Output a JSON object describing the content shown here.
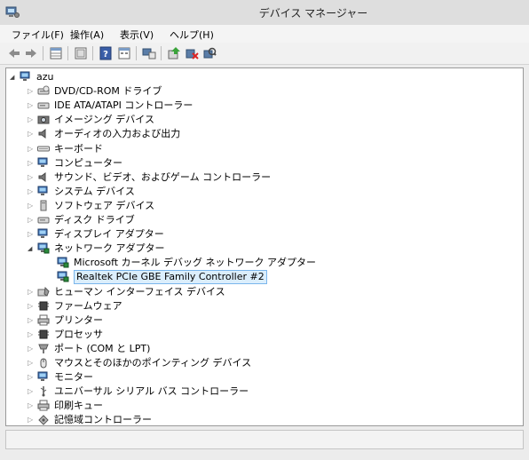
{
  "window": {
    "title": "デバイス マネージャー"
  },
  "menu": [
    "ファイル(F)",
    "操作(A)",
    "表示(V)",
    "ヘルプ(H)"
  ],
  "toolbar": {
    "buttons": [
      "back-icon",
      "forward-icon",
      "properties-grid-icon",
      "show-hide-tree-icon",
      "help-icon",
      "view-icon",
      "devices-icon",
      "update-driver-icon",
      "uninstall-icon",
      "scan-hardware-icon"
    ]
  },
  "tree": {
    "root": "azu",
    "categories": [
      {
        "label": "DVD/CD-ROM ドライブ",
        "icon": "dvd-drive-icon"
      },
      {
        "label": "IDE ATA/ATAPI コントローラー",
        "icon": "ide-controller-icon"
      },
      {
        "label": "イメージング デバイス",
        "icon": "imaging-device-icon"
      },
      {
        "label": "オーディオの入力および出力",
        "icon": "speaker-icon"
      },
      {
        "label": "キーボード",
        "icon": "keyboard-icon"
      },
      {
        "label": "コンピューター",
        "icon": "computer-icon"
      },
      {
        "label": "サウンド、ビデオ、およびゲーム コントローラー",
        "icon": "sound-icon"
      },
      {
        "label": "システム デバイス",
        "icon": "system-device-icon"
      },
      {
        "label": "ソフトウェア デバイス",
        "icon": "software-device-icon"
      },
      {
        "label": "ディスク ドライブ",
        "icon": "disk-drive-icon"
      },
      {
        "label": "ディスプレイ アダプター",
        "icon": "display-adapter-icon"
      },
      {
        "label": "ネットワーク アダプター",
        "icon": "network-adapter-icon",
        "expanded": true,
        "children": [
          {
            "label": "Microsoft カーネル デバッグ ネットワーク アダプター",
            "icon": "network-card-icon"
          },
          {
            "label": "Realtek PCIe GBE Family Controller #2",
            "icon": "network-card-icon",
            "selected": true
          }
        ]
      },
      {
        "label": "ヒューマン インターフェイス デバイス",
        "icon": "hid-icon"
      },
      {
        "label": "ファームウェア",
        "icon": "firmware-icon"
      },
      {
        "label": "プリンター",
        "icon": "printer-icon"
      },
      {
        "label": "プロセッサ",
        "icon": "processor-icon"
      },
      {
        "label": "ポート (COM と LPT)",
        "icon": "port-icon"
      },
      {
        "label": "マウスとそのほかのポインティング デバイス",
        "icon": "mouse-icon"
      },
      {
        "label": "モニター",
        "icon": "monitor-icon"
      },
      {
        "label": "ユニバーサル シリアル バス コントローラー",
        "icon": "usb-icon"
      },
      {
        "label": "印刷キュー",
        "icon": "print-queue-icon"
      },
      {
        "label": "記憶域コントローラー",
        "icon": "storage-controller-icon"
      }
    ]
  },
  "colors": {
    "selection_bg": "#dbeefc",
    "selection_border": "#7ab6ec"
  }
}
